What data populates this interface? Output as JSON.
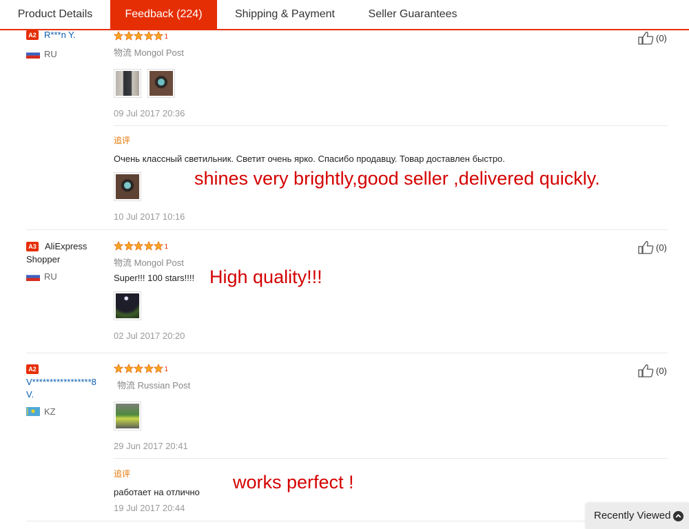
{
  "tabs": [
    {
      "label": "Product Details"
    },
    {
      "label": "Feedback (224)"
    },
    {
      "label": "Shipping & Payment"
    },
    {
      "label": "Seller Guarantees"
    }
  ],
  "colors": {
    "accent": "#e62e04",
    "link": "#0a5fb0",
    "annotation": "#d40000"
  },
  "reviews": [
    {
      "badge": "A2",
      "user": "R***n Y.",
      "country": "RU",
      "star_count": "1",
      "logistics": "物流 Mongol Post",
      "date": "09 Jul 2017 20:36",
      "helpful": "(0)",
      "additional": {
        "label": "追评",
        "text": "Очень классный светильник. Светит очень ярко. Спасибо продавцу. Товар доставлен быстро.",
        "date": "10 Jul 2017 10:16"
      },
      "annotation": "shines very brightly,good seller ,delivered quickly."
    },
    {
      "badge": "A3",
      "user_line1": "AliExpress",
      "user_line2": "Shopper",
      "country": "RU",
      "star_count": "1",
      "logistics": "物流 Mongol Post",
      "text": "Super!!! 100 stars!!!!",
      "date": "02 Jul 2017 20:20",
      "helpful": "(0)",
      "annotation": "High quality!!!"
    },
    {
      "badge": "A2",
      "user_line1": "V*****************8",
      "user_line2": "V.",
      "country": "KZ",
      "star_count": "1",
      "logistics": "物流 Russian Post",
      "date": "29 Jun 2017 20:41",
      "helpful": "(0)",
      "additional": {
        "label": "追评",
        "text": "работает на отлично",
        "date": "19 Jul 2017 20:44"
      },
      "annotation": "works perfect !"
    }
  ],
  "recently_viewed": {
    "label": "Recently Viewed",
    "icon": "chevron-up-icon"
  }
}
